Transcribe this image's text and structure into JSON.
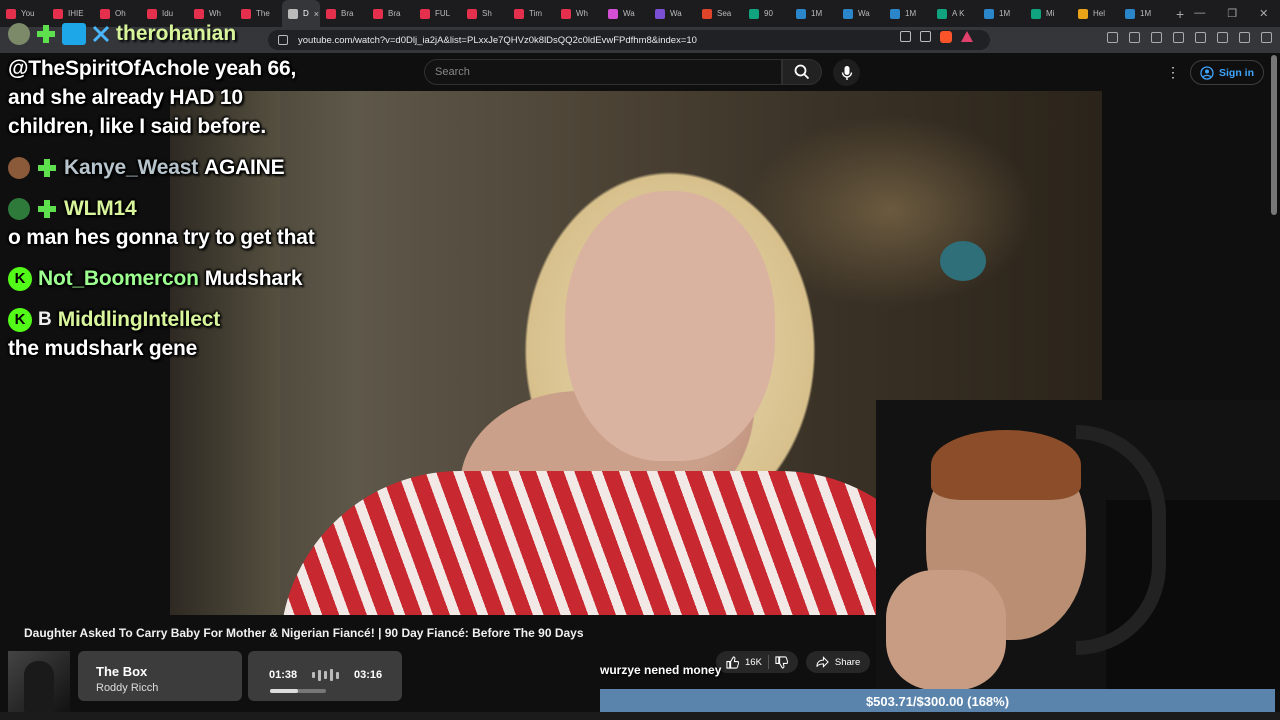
{
  "browser": {
    "tabs": [
      {
        "label": "You",
        "color": "#e5304d"
      },
      {
        "label": "IHIE",
        "color": "#e5304d"
      },
      {
        "label": "Oh",
        "color": "#e5304d"
      },
      {
        "label": "Idu",
        "color": "#e5304d"
      },
      {
        "label": "Wh",
        "color": "#e5304d"
      },
      {
        "label": "The",
        "color": "#e5304d"
      },
      {
        "label": "D",
        "color": "#bbbbbb",
        "active": true
      },
      {
        "label": "Bra",
        "color": "#e5304d"
      },
      {
        "label": "Bra",
        "color": "#e5304d"
      },
      {
        "label": "FUL",
        "color": "#e5304d"
      },
      {
        "label": "Sh",
        "color": "#e5304d"
      },
      {
        "label": "Tim",
        "color": "#e5304d"
      },
      {
        "label": "Wh",
        "color": "#e5304d"
      },
      {
        "label": "Wa",
        "color": "#d44fd4"
      },
      {
        "label": "Wa",
        "color": "#7a4fd4"
      },
      {
        "label": "Sea",
        "color": "#e0442b"
      },
      {
        "label": "90",
        "color": "#10a37f"
      },
      {
        "label": "1M",
        "color": "#2a86c8"
      },
      {
        "label": "Wa",
        "color": "#2a86c8"
      },
      {
        "label": "1M",
        "color": "#2a86c8"
      },
      {
        "label": "A K",
        "color": "#10a37f"
      },
      {
        "label": "1M",
        "color": "#2a86c8"
      },
      {
        "label": "Mi",
        "color": "#10a37f"
      },
      {
        "label": "Hel",
        "color": "#e8a317"
      },
      {
        "label": "1M",
        "color": "#2a86c8"
      }
    ],
    "close_glyph": "×",
    "new_tab_glyph": "+",
    "url": "youtube.com/watch?v=d0Dlj_ia2jA&list=PLxxJe7QHVz0k8lDsQQ2c0ldEvwFPdfhm8&index=10"
  },
  "youtube": {
    "search_placeholder": "Search",
    "sign_in": "Sign in",
    "more_glyph": "⋮",
    "video_title": "Daughter Asked To Carry Baby For Mother & Nigerian Fiancé! | 90 Day Fiancé: Before The 90 Days",
    "like_count": "16K",
    "share_label": "Share"
  },
  "chat": {
    "top_user": "therohanian",
    "messages": [
      {
        "lines": [
          "@TheSpiritOfAchole yeah 66,",
          "and she already HAD 10",
          "children, like I said before."
        ]
      },
      {
        "user": "Kanye_Weast",
        "text": "AGAINE",
        "name_color": "gray"
      },
      {
        "user": "WLM14",
        "text": "o man hes gonna try to get that",
        "name_color": "lime"
      },
      {
        "user": "Not_Boomercon",
        "text": "Mudshark",
        "name_color": "green",
        "badge": "K"
      },
      {
        "user": "MiddlingIntellect",
        "text": "the mudshark gene",
        "name_color": "lime",
        "badge": "K",
        "badge2": "B"
      }
    ]
  },
  "caption": "wurzye nened money",
  "music": {
    "title": "The Box",
    "artist": "Roddy Ricch",
    "current": "01:38",
    "total": "03:16",
    "progress": 0.5
  },
  "goal": {
    "text": "$503.71/$300.00 (168%)",
    "fraction": 1.0
  }
}
